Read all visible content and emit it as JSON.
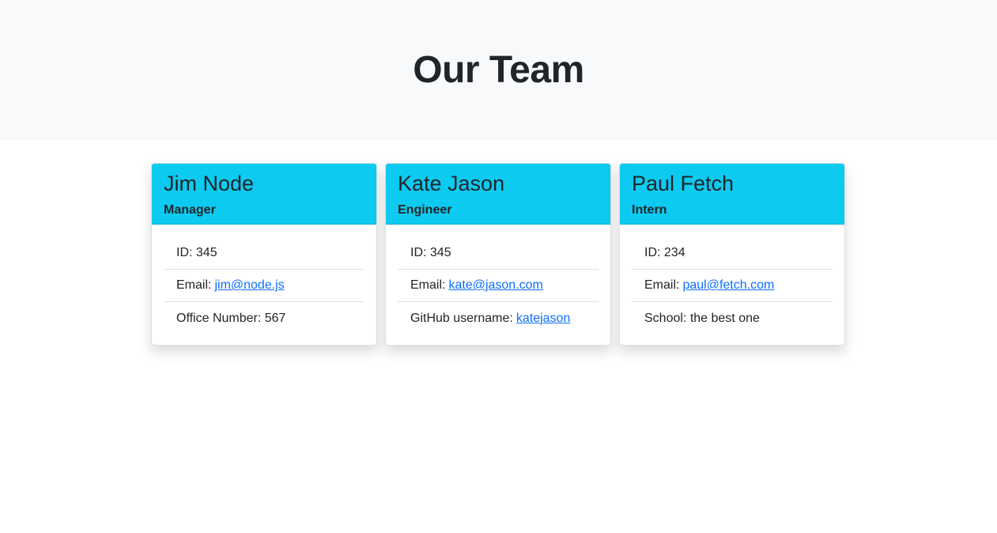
{
  "page": {
    "title": "Our Team"
  },
  "team": [
    {
      "name": "Jim Node",
      "role": "Manager",
      "id_text": "ID: 345",
      "email_label": "Email:",
      "email": "jim@node.js",
      "extra_label": "Office Number: 567",
      "extra_link": ""
    },
    {
      "name": "Kate Jason",
      "role": "Engineer",
      "id_text": "ID: 345",
      "email_label": "Email:",
      "email": "kate@jason.com",
      "extra_label": "GitHub username:",
      "extra_link": "katejason"
    },
    {
      "name": "Paul Fetch",
      "role": "Intern",
      "id_text": "ID: 234",
      "email_label": "Email:",
      "email": "paul@fetch.com",
      "extra_label": "School: the best one",
      "extra_link": ""
    }
  ],
  "colors": {
    "header_bg": "#0dcaf0",
    "hero_bg": "#f8f9fa",
    "link": "#0d6efd"
  }
}
